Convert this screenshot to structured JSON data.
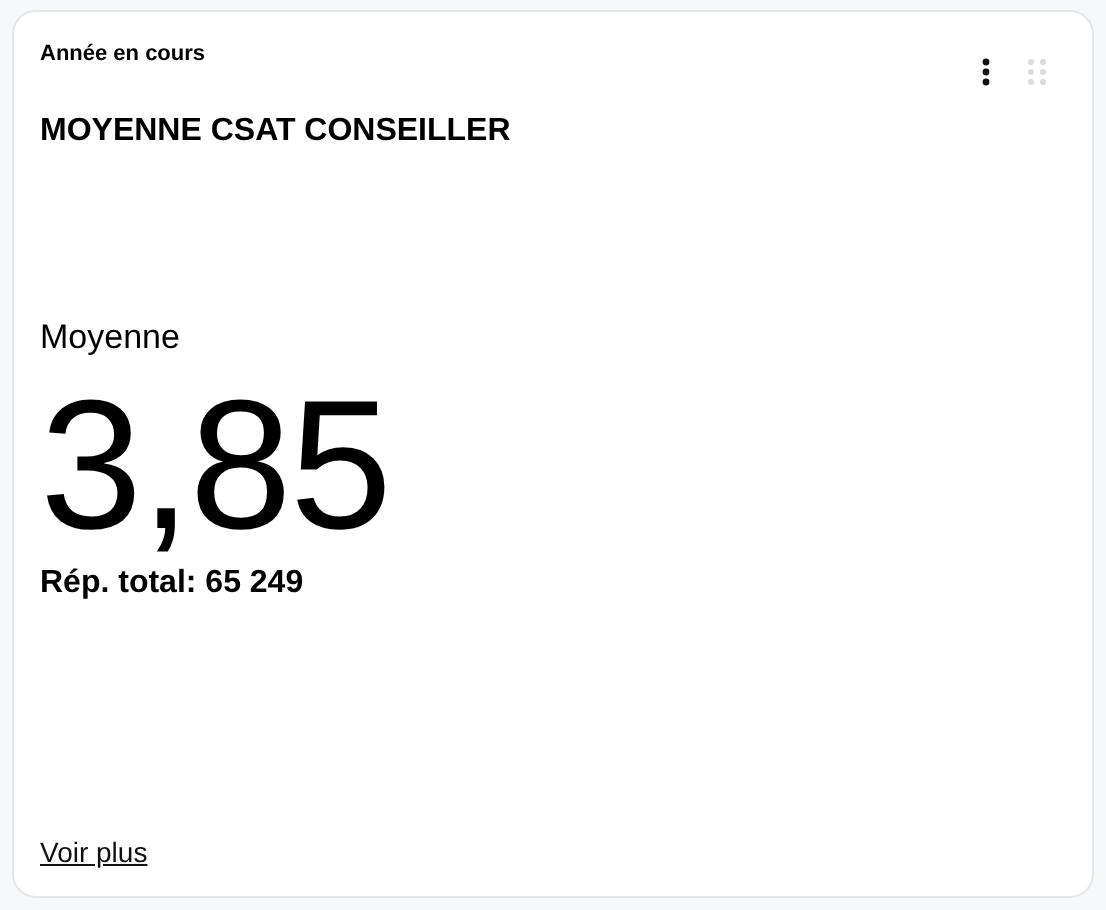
{
  "card": {
    "period": "Année en cours",
    "title": "MOYENNE CSAT CONSEILLER",
    "metric_label": "Moyenne",
    "value": "3,85",
    "total": "Rép. total: 65 249",
    "link": "Voir plus"
  }
}
